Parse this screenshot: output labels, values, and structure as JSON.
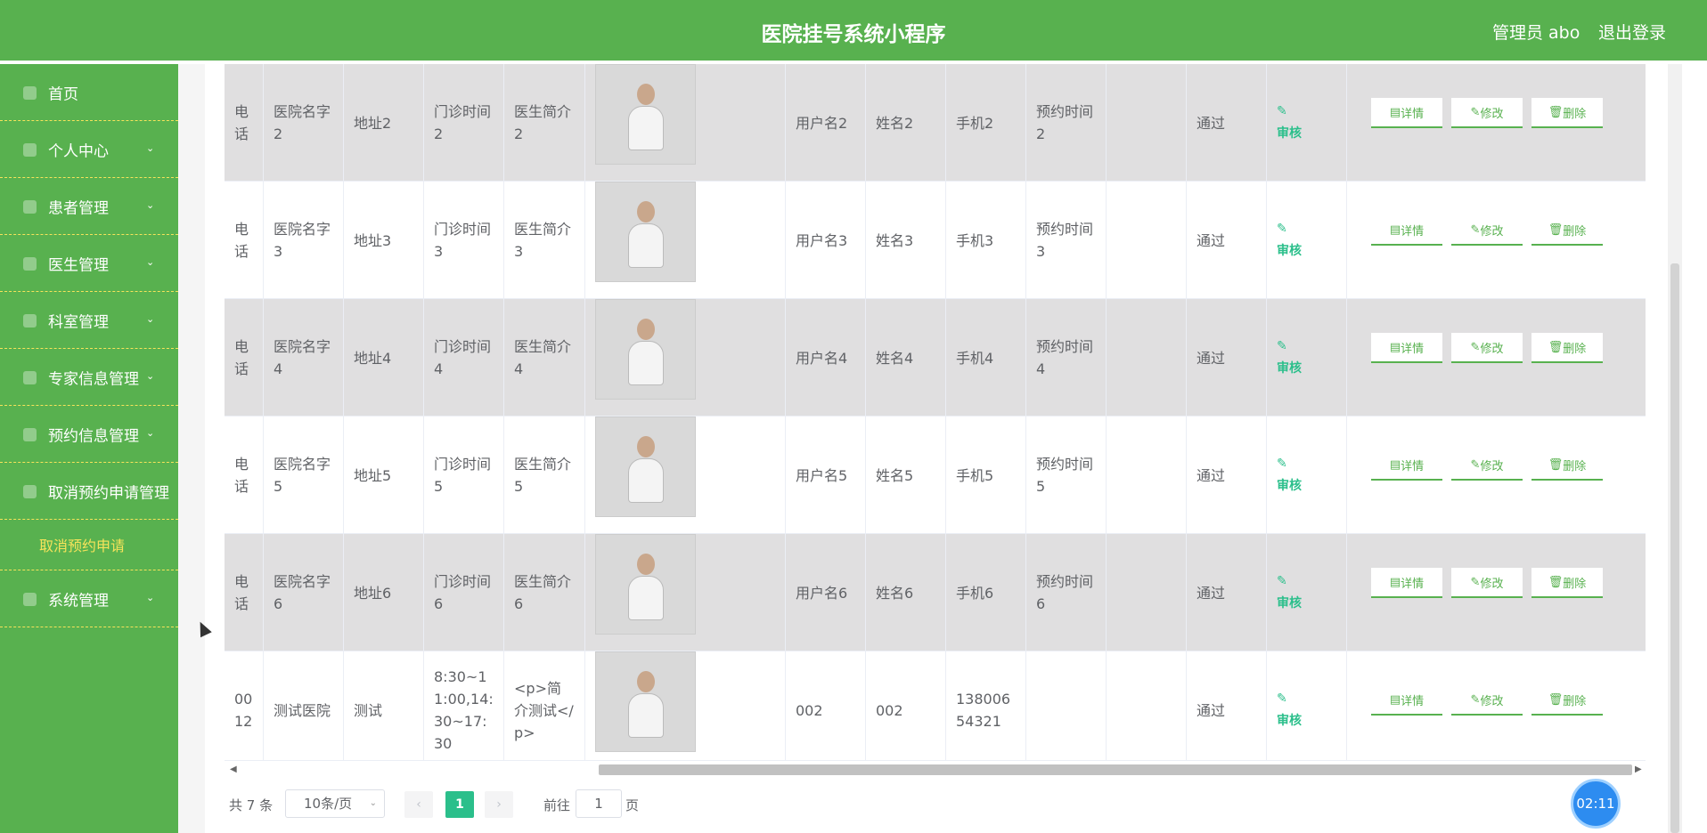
{
  "header": {
    "title": "医院挂号系统小程序",
    "admin_label": "管理员 abo",
    "logout_label": "退出登录",
    "bg_color": "#58b14f"
  },
  "sidebar": {
    "items": [
      {
        "label": "首页",
        "icon": "home-icon",
        "expandable": false
      },
      {
        "label": "个人中心",
        "icon": "user-icon",
        "expandable": true
      },
      {
        "label": "患者管理",
        "icon": "patient-icon",
        "expandable": true
      },
      {
        "label": "医生管理",
        "icon": "doctor-icon",
        "expandable": true
      },
      {
        "label": "科室管理",
        "icon": "department-icon",
        "expandable": true
      },
      {
        "label": "专家信息管理",
        "icon": "expert-icon",
        "expandable": true
      },
      {
        "label": "预约信息管理",
        "icon": "calendar-icon",
        "expandable": true
      },
      {
        "label": "取消预约申请管理",
        "icon": "cancel-icon",
        "expandable": false
      },
      {
        "label": "取消预约申请",
        "icon": "",
        "expandable": false,
        "submenu": true
      },
      {
        "label": "系统管理",
        "icon": "settings-icon",
        "expandable": true
      }
    ]
  },
  "table": {
    "rows": [
      {
        "c0": "电话",
        "hospital": "医院名字2",
        "address": "地址2",
        "hours": "门诊时间2",
        "intro": "医生简介2",
        "username": "用户名2",
        "name": "姓名2",
        "phone": "手机2",
        "time": "预约时间2",
        "status": "通过"
      },
      {
        "c0": "电话",
        "hospital": "医院名字3",
        "address": "地址3",
        "hours": "门诊时间3",
        "intro": "医生简介3",
        "username": "用户名3",
        "name": "姓名3",
        "phone": "手机3",
        "time": "预约时间3",
        "status": "通过"
      },
      {
        "c0": "电话",
        "hospital": "医院名字4",
        "address": "地址4",
        "hours": "门诊时间4",
        "intro": "医生简介4",
        "username": "用户名4",
        "name": "姓名4",
        "phone": "手机4",
        "time": "预约时间4",
        "status": "通过"
      },
      {
        "c0": "电话",
        "hospital": "医院名字5",
        "address": "地址5",
        "hours": "门诊时间5",
        "intro": "医生简介5",
        "username": "用户名5",
        "name": "姓名5",
        "phone": "手机5",
        "time": "预约时间5",
        "status": "通过"
      },
      {
        "c0": "电话",
        "hospital": "医院名字6",
        "address": "地址6",
        "hours": "门诊时间6",
        "intro": "医生简介6",
        "username": "用户名6",
        "name": "姓名6",
        "phone": "手机6",
        "time": "预约时间6",
        "status": "通过"
      },
      {
        "c0": "0012",
        "hospital": "测试医院",
        "address": "测试",
        "hours": "8:30~11:00,14:30~17:30",
        "intro": "<p>简介测试</p>",
        "username": "002",
        "name": "002",
        "phone": "13800654321",
        "time": "",
        "status": "通过"
      }
    ],
    "audit_label": "审核",
    "detail_label": "详情",
    "edit_label": "修改",
    "delete_label": "删除"
  },
  "pagination": {
    "total": "共 7 条",
    "page_size": "10条/页",
    "current_page": "1",
    "goto_label": "前往",
    "goto_value": "1",
    "page_unit": "页"
  },
  "timer": {
    "value": "02:11"
  }
}
